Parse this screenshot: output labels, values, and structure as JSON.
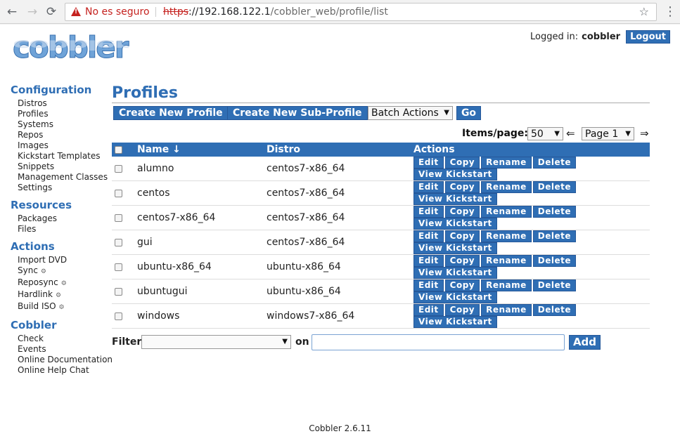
{
  "browser": {
    "security_label": "No es seguro",
    "url_scheme": "https",
    "url_host": "://192.168.122.1",
    "url_path": "/cobbler_web/profile/list"
  },
  "header": {
    "logo_text": "cobbler",
    "logged_in_label": "Logged in:",
    "username": "cobbler",
    "logout_label": "Logout"
  },
  "sidebar": {
    "sections": [
      {
        "title": "Configuration",
        "items": [
          "Distros",
          "Profiles",
          "Systems",
          "Repos",
          "Images",
          "Kickstart Templates",
          "Snippets",
          "Management Classes",
          "Settings"
        ]
      },
      {
        "title": "Resources",
        "items": [
          "Packages",
          "Files"
        ]
      },
      {
        "title": "Actions",
        "items": [
          "Import DVD",
          "Sync",
          "Reposync",
          "Hardlink",
          "Build ISO"
        ]
      },
      {
        "title": "Cobbler",
        "items": [
          "Check",
          "Events",
          "Online Documentation",
          "Online Help Chat"
        ]
      }
    ]
  },
  "main": {
    "title": "Profiles",
    "create_profile_label": "Create New Profile",
    "create_sub_label": "Create New Sub-Profile",
    "batch_actions_label": "Batch Actions",
    "go_label": "Go",
    "items_per_page_label": "Items/page:",
    "items_per_page_value": "50",
    "page_value": "Page 1",
    "columns": [
      "Name ↓",
      "Distro",
      "Actions"
    ],
    "action_labels": [
      "Edit",
      "Copy",
      "Rename",
      "Delete",
      "View Kickstart"
    ],
    "rows": [
      {
        "name": "alumno",
        "distro": "centos7-x86_64"
      },
      {
        "name": "centos",
        "distro": "centos7-x86_64"
      },
      {
        "name": "centos7-x86_64",
        "distro": "centos7-x86_64"
      },
      {
        "name": "gui",
        "distro": "centos7-x86_64"
      },
      {
        "name": "ubuntu-x86_64",
        "distro": "ubuntu-x86_64"
      },
      {
        "name": "ubuntugui",
        "distro": "ubuntu-x86_64"
      },
      {
        "name": "windows",
        "distro": "windows7-x86_64"
      }
    ],
    "filter_label": "Filter",
    "on_label": "on",
    "add_label": "Add"
  },
  "footer": {
    "version": "Cobbler 2.6.11"
  }
}
